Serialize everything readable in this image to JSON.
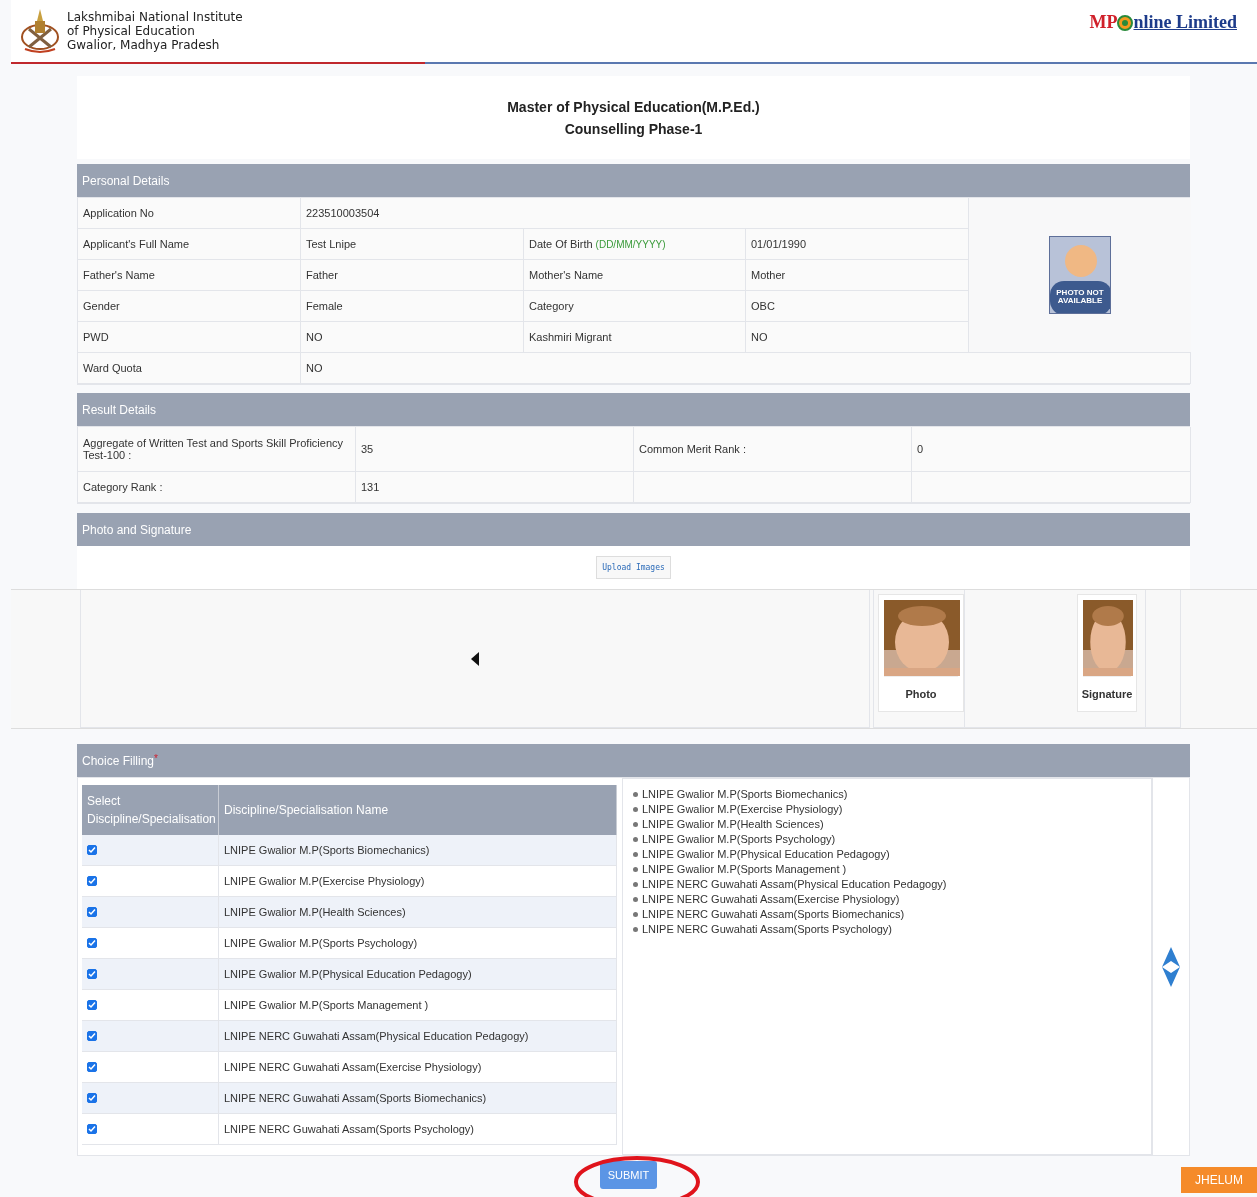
{
  "header": {
    "institute_lines": [
      "Lakshmibai National Institute",
      "of Physical Education",
      "Gwalior, Madhya Pradesh"
    ],
    "brand_prefix": "MP",
    "brand_suffix": "nline Limited"
  },
  "title_lines": [
    "Master of Physical Education(M.P.Ed.)",
    "Counselling Phase-1"
  ],
  "personal_details": {
    "title": "Personal Details",
    "photo_placeholder": "PHOTO NOT AVAILABLE",
    "rows": [
      {
        "cells": [
          {
            "label": "Application No",
            "value": "223510003504"
          }
        ]
      },
      {
        "cells": [
          {
            "label": "Applicant's Full Name",
            "value": "Test Lnipe"
          },
          {
            "label": "Date Of Birth",
            "hint": "(DD/MM/YYYY)",
            "value": "01/01/1990"
          }
        ]
      },
      {
        "cells": [
          {
            "label": "Father's Name",
            "value": "Father"
          },
          {
            "label": "Mother's Name",
            "value": "Mother"
          }
        ]
      },
      {
        "cells": [
          {
            "label": "Gender",
            "value": "Female"
          },
          {
            "label": "Category",
            "value": "OBC"
          }
        ]
      },
      {
        "cells": [
          {
            "label": "PWD",
            "value": "NO"
          },
          {
            "label": "Kashmiri Migrant",
            "value": "NO"
          }
        ]
      },
      {
        "cells": [
          {
            "label": "Ward Quota",
            "value": "NO"
          }
        ]
      }
    ]
  },
  "result_details": {
    "title": "Result Details",
    "rows": [
      {
        "cells": [
          {
            "label": "Aggregate of Written Test and Sports Skill Proficiency Test-100 :",
            "value": "35"
          },
          {
            "label": "Common Merit Rank :",
            "value": "0"
          }
        ]
      },
      {
        "cells": [
          {
            "label": "Category Rank :",
            "value": "131"
          }
        ]
      }
    ]
  },
  "photo_signature": {
    "title": "Photo and Signature",
    "upload_button": "Upload Images",
    "images": [
      {
        "caption": "Photo"
      },
      {
        "caption": "Signature"
      }
    ]
  },
  "choice_filling": {
    "title": "Choice Filling",
    "required_mark": "*",
    "columns": [
      "Select Discipline/Specialisation",
      "Discipline/Specialisation Name"
    ],
    "rows": [
      {
        "checked": true,
        "name": "LNIPE Gwalior M.P(Sports Biomechanics)"
      },
      {
        "checked": true,
        "name": "LNIPE Gwalior M.P(Exercise Physiology)"
      },
      {
        "checked": true,
        "name": "LNIPE Gwalior M.P(Health Sciences)"
      },
      {
        "checked": true,
        "name": "LNIPE Gwalior M.P(Sports Psychology)"
      },
      {
        "checked": true,
        "name": "LNIPE Gwalior M.P(Physical Education Pedagogy)"
      },
      {
        "checked": true,
        "name": "LNIPE Gwalior M.P(Sports Management  )"
      },
      {
        "checked": true,
        "name": "LNIPE NERC Guwahati Assam(Physical Education Pedagogy)"
      },
      {
        "checked": true,
        "name": "LNIPE NERC Guwahati Assam(Exercise Physiology)"
      },
      {
        "checked": true,
        "name": "LNIPE NERC Guwahati Assam(Sports Biomechanics)"
      },
      {
        "checked": true,
        "name": "LNIPE NERC Guwahati Assam(Sports Psychology)"
      }
    ],
    "order": [
      "LNIPE Gwalior M.P(Sports Biomechanics)",
      "LNIPE Gwalior M.P(Exercise Physiology)",
      "LNIPE Gwalior M.P(Health Sciences)",
      "LNIPE Gwalior M.P(Sports Psychology)",
      "LNIPE Gwalior M.P(Physical Education Pedagogy)",
      "LNIPE Gwalior M.P(Sports Management  )",
      "LNIPE NERC Guwahati Assam(Physical Education Pedagogy)",
      "LNIPE NERC Guwahati Assam(Exercise Physiology)",
      "LNIPE NERC Guwahati Assam(Sports Biomechanics)",
      "LNIPE NERC Guwahati Assam(Sports Psychology)"
    ]
  },
  "submit_button": "SUBMIT",
  "server_badge": "JHELUM"
}
